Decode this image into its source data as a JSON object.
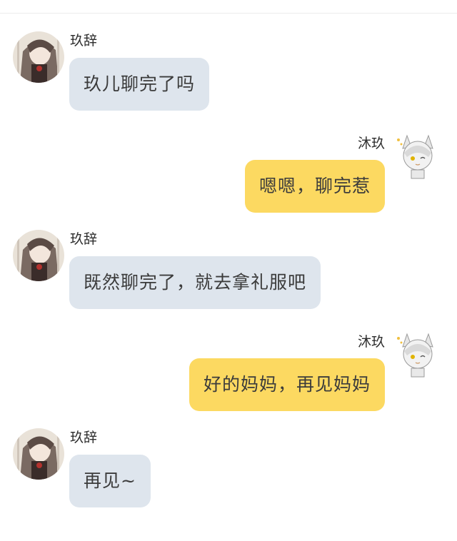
{
  "messages": [
    {
      "side": "left",
      "sender": "玖辞",
      "text": "玖儿聊完了吗"
    },
    {
      "side": "right",
      "sender": "沐玖",
      "text": "嗯嗯，聊完惹"
    },
    {
      "side": "left",
      "sender": "玖辞",
      "text": "既然聊完了，就去拿礼服吧"
    },
    {
      "side": "right",
      "sender": "沐玖",
      "text": "好的妈妈，再见妈妈"
    },
    {
      "side": "left",
      "sender": "玖辞",
      "text": "再见~"
    }
  ],
  "colors": {
    "left_bubble": "#dee5ed",
    "right_bubble": "#fcd961",
    "background": "#ffffff"
  },
  "icons": {
    "left_avatar": "anime-girl-avatar",
    "right_avatar": "cat-ear-chibi-avatar"
  }
}
